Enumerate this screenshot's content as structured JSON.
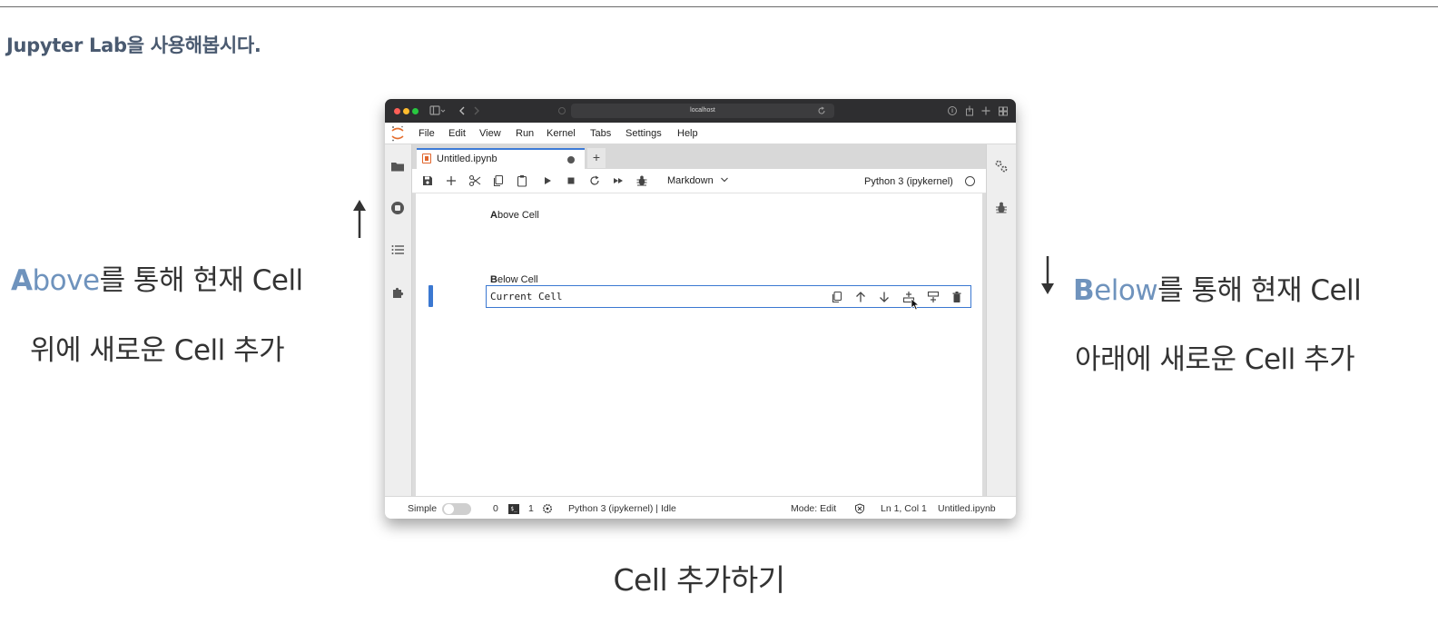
{
  "slide": {
    "title": "Jupyter Lab을 사용해봅시다.",
    "left_note": {
      "accent_letter": "A",
      "accent_rest": "bove",
      "line1_rest": "를 통해 현재 Cell",
      "line2": "위에 새로운 Cell 추가"
    },
    "right_note": {
      "accent_letter": "B",
      "accent_rest": "elow",
      "line1_rest": "를 통해 현재 Cell",
      "line2": "아래에 새로운 Cell 추가"
    },
    "caption": "Cell 추가하기",
    "colors": {
      "accent": "#6f93bd",
      "title": "#4a5a70"
    }
  },
  "browser": {
    "url": "localhost",
    "traffic_lights": [
      "#ff5f57",
      "#febc2e",
      "#28c840"
    ]
  },
  "menubar": {
    "items": [
      "File",
      "Edit",
      "View",
      "Run",
      "Kernel",
      "Tabs",
      "Settings",
      "Help"
    ]
  },
  "tab": {
    "name": "Untitled.ipynb",
    "new_tab": "+"
  },
  "toolbar": {
    "icons": [
      "save-icon",
      "add-cell-icon",
      "cut-icon",
      "copy-icon",
      "paste-icon",
      "run-icon",
      "stop-icon",
      "restart-icon",
      "fast-forward-icon",
      "debug-icon"
    ],
    "cell_type": "Markdown",
    "kernel": "Python 3 (ipykernel)"
  },
  "notebook": {
    "above_cell": {
      "bold": "A",
      "rest": "bove Cell"
    },
    "current_cell": "Current Cell",
    "below_cell": {
      "bold": "B",
      "rest": "elow Cell"
    },
    "cell_toolbar_icons": [
      "duplicate-icon",
      "move-up-icon",
      "move-down-icon",
      "insert-below-icon",
      "insert-above-icon",
      "delete-icon"
    ]
  },
  "statusbar": {
    "simple_label": "Simple",
    "terminals_count": "0",
    "kernels_count": "1",
    "kernel_status": "Python 3 (ipykernel) | Idle",
    "mode": "Mode: Edit",
    "cursor": "Ln 1, Col 1",
    "file": "Untitled.ipynb"
  }
}
